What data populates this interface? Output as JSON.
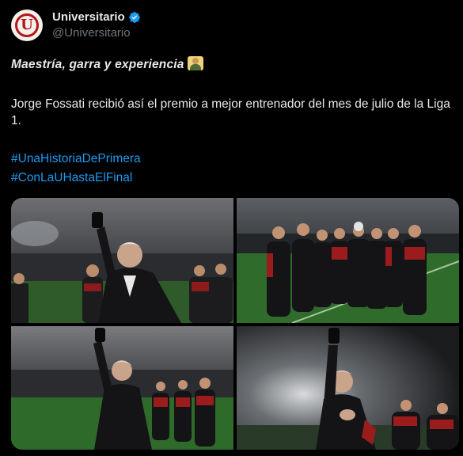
{
  "account": {
    "display_name": "Universitario",
    "handle": "@Universitario",
    "avatar_letter": "U",
    "verified": true,
    "brand_color": "#b3161d",
    "verified_color": "#1d9bf0"
  },
  "tweet": {
    "headline": "Maestría, garra y experiencia",
    "headline_emoji": "teacher-emoji",
    "body": "Jorge Fossati recibió así el premio a mejor entrenador del mes de julio de la Liga 1.",
    "hashtags": [
      "#UnaHistoriaDePrimera",
      "#ConLaUHastaElFinal"
    ]
  },
  "media": {
    "photos": [
      {
        "icon": "photo-coach-raising-award"
      },
      {
        "icon": "photo-coaching-staff-group"
      },
      {
        "icon": "photo-coach-award-stadium"
      },
      {
        "icon": "photo-coach-award-closeup"
      }
    ]
  },
  "colors": {
    "background": "#000000",
    "text": "#e7e9ea",
    "secondary_text": "#71767b",
    "link": "#1d9bf0"
  }
}
